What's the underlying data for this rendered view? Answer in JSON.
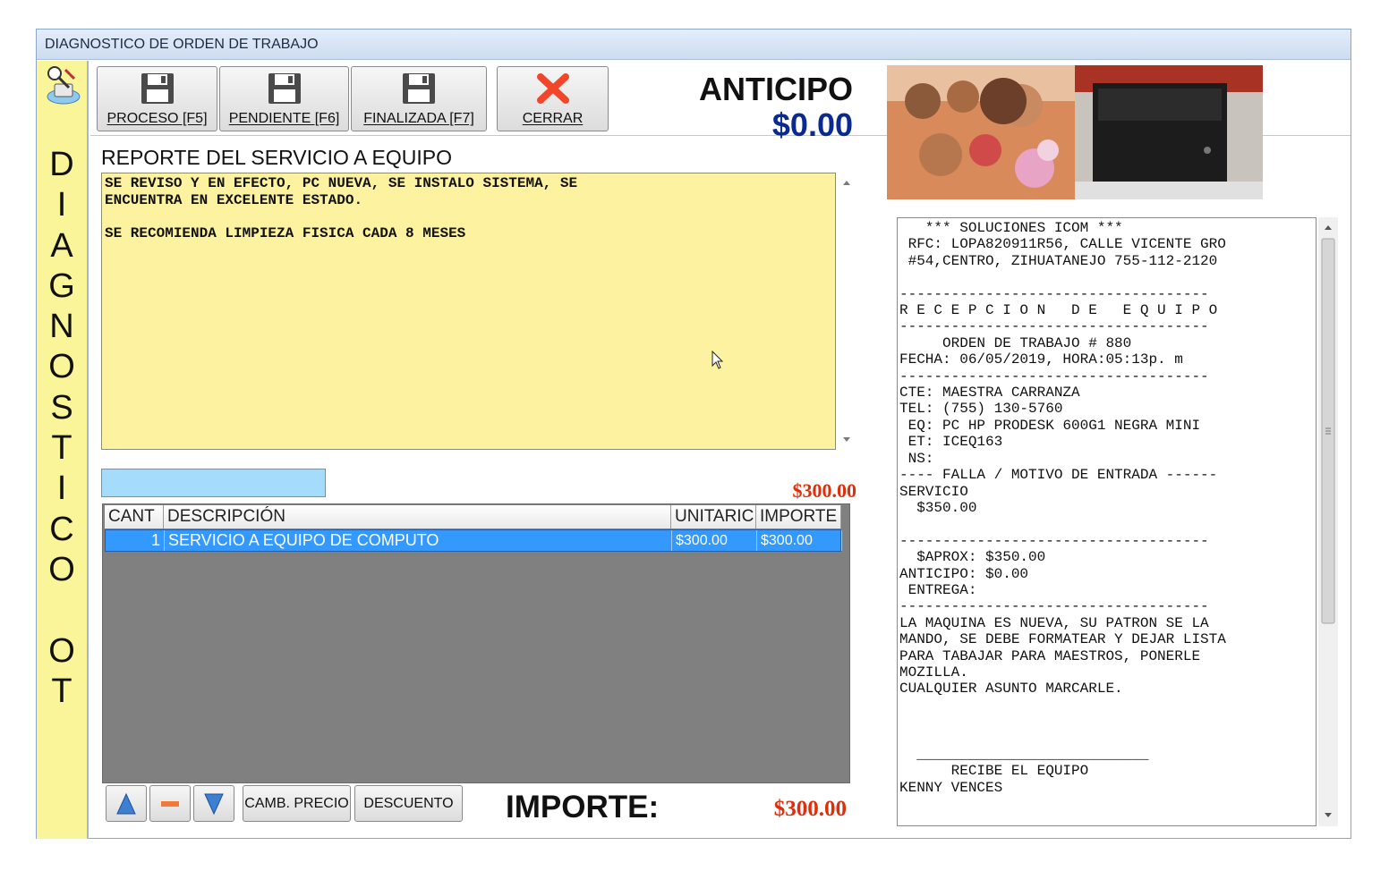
{
  "window": {
    "title": "DIAGNOSTICO DE ORDEN DE TRABAJO"
  },
  "sidebar": {
    "vertical_text": [
      "D",
      "I",
      "A",
      "G",
      "N",
      "O",
      "S",
      "T",
      "I",
      "C",
      "O",
      "",
      "O",
      "T"
    ]
  },
  "toolbar": {
    "proceso_label": "PROCESO [F5]",
    "pendiente_label": "PENDIENTE [F6]",
    "finalizada_label": "FINALIZADA [F7]",
    "cerrar_label": "CERRAR"
  },
  "anticipo": {
    "label": "ANTICIPO",
    "value": "$0.00"
  },
  "report": {
    "title": "REPORTE DEL SERVICIO A EQUIPO",
    "text": "SE REVISO Y EN EFECTO, PC NUEVA, SE INSTALO SISTEMA, SE\nENCUENTRA EN EXCELENTE ESTADO.\n\nSE RECOMIENDA LIMPIEZA FISICA CADA 8 MESES"
  },
  "search": {
    "value": ""
  },
  "total_top": "$300.00",
  "grid": {
    "columns": [
      "CANT",
      "DESCRIPCIÓN",
      "UNITARIC",
      "IMPORTE"
    ],
    "rows": [
      {
        "cant": "1",
        "descripcion": "SERVICIO A EQUIPO DE COMPUTO",
        "unitario": "$300.00",
        "importe": "$300.00"
      }
    ]
  },
  "bottom_toolbar": {
    "camb_precio_label": "CAMB. PRECIO",
    "descuento_label": "DESCUENTO"
  },
  "importe": {
    "label": "IMPORTE:",
    "value": "$300.00"
  },
  "ticket": {
    "text": "   *** SOLUCIONES ICOM ***\n RFC: LOPA820911R56, CALLE VICENTE GRO\n #54,CENTRO, ZIHUATANEJO 755-112-2120\n\n------------------------------------\nR E C E P C I O N   D E   E Q U I P O\n------------------------------------\n     ORDEN DE TRABAJO # 880\nFECHA: 06/05/2019, HORA:05:13p. m\n------------------------------------\nCTE: MAESTRA CARRANZA\nTEL: (755) 130-5760\n EQ: PC HP PRODESK 600G1 NEGRA MINI\n ET: ICEQ163\n NS:\n---- FALLA / MOTIVO DE ENTRADA ------\nSERVICIO\n  $350.00\n\n------------------------------------\n  $APROX: $350.00\nANTICIPO: $0.00\n ENTREGA:\n------------------------------------\nLA MAQUINA ES NUEVA, SU PATRON SE LA\nMANDO, SE DEBE FORMATEAR Y DEJAR LISTA\nPARA TABAJAR PARA MAESTROS, PONERLE\nMOZILLA.\nCUALQUIER ASUNTO MARCARLE.\n\n\n\n  ___________________________\n      RECIBE EL EQUIPO\nKENNY VENCES"
  },
  "colors": {
    "sidebar": "#fbf59a",
    "report_bg": "#fcf29f",
    "anticipo_value": "#0b2a90",
    "total": "#e02e0c",
    "row_selected": "#3399ff"
  }
}
